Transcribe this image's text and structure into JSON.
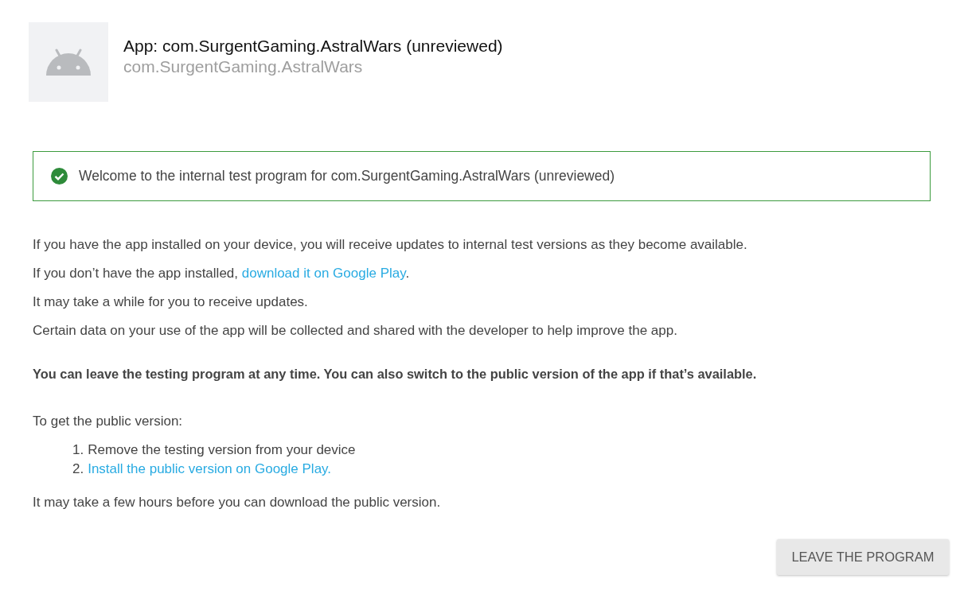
{
  "app": {
    "title": "App: com.SurgentGaming.AstralWars (unreviewed)",
    "package": "com.SurgentGaming.AstralWars"
  },
  "banner": {
    "text": "Welcome to the internal test program for com.SurgentGaming.AstralWars (unreviewed)"
  },
  "paragraphs": [
    {
      "text": "If you have the app installed on your device, you will receive updates to internal test versions as they become available."
    },
    {
      "text": "If you don’t have the app installed, ",
      "link": "download it on Google Play",
      "after": "."
    },
    {
      "text": "It may take a while for you to receive updates."
    },
    {
      "text": "Certain data on your use of the app will be collected and shared with the developer to help improve the app."
    }
  ],
  "notice": "You can leave the testing program at any time. You can also switch to the public version of the app if that’s available.",
  "steps_intro": "To get the public version:",
  "steps": [
    {
      "number": "1.",
      "text": "Remove the testing version from your device",
      "kind": "text"
    },
    {
      "number": "2.",
      "text": "Install the public version on Google Play.",
      "kind": "link"
    }
  ],
  "footer": "It may take a few hours before you can download the public version.",
  "button": "LEAVE THE PROGRAM"
}
